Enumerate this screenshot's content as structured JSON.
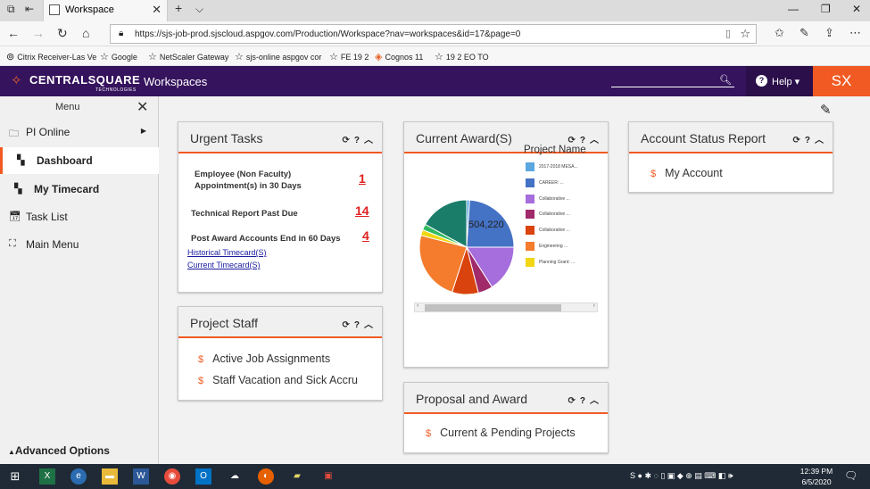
{
  "browser": {
    "tab_title": "Workspace",
    "url": "https://sjs-job-prod.sjscloud.aspgov.com/Production/Workspace?nav=workspaces&id=17&page=0",
    "favorites": [
      "Citrix Receiver-Las Ve",
      "Google",
      "NetScaler Gateway",
      "sjs-online aspgov cor",
      "FE 19 2",
      "Cognos 11",
      "19 2 EO TO"
    ]
  },
  "header": {
    "brand": "CENTRALSQUARE",
    "brand_sub": "TECHNOLOGIES",
    "section": "Workspaces",
    "help_label": "Help",
    "user_initials": "SX"
  },
  "sidebar": {
    "menu_label": "Menu",
    "items": [
      {
        "label": "PI Online"
      },
      {
        "label": "Dashboard"
      },
      {
        "label": "My Timecard"
      },
      {
        "label": "Task List"
      },
      {
        "label": "Main Menu"
      }
    ],
    "advanced_label": "Advanced Options"
  },
  "cards": {
    "urgent": {
      "title": "Urgent Tasks",
      "tasks": [
        {
          "label": "Employee (Non Faculty) Appointment(s) in 30 Days",
          "count": "1"
        },
        {
          "label": "Technical Report Past Due",
          "count": "14"
        },
        {
          "label": "Post Award Accounts End in 60 Days",
          "count": "4"
        }
      ],
      "links": [
        "Historical Timecard(S)",
        "Current Timecard(S)"
      ]
    },
    "staff": {
      "title": "Project Staff",
      "links": [
        "Active Job Assignments",
        "Staff Vacation and Sick Accru"
      ]
    },
    "award": {
      "title": "Current Award(S)",
      "legend_title": "Project Name",
      "more": "..."
    },
    "proposal": {
      "title": "Proposal and Award",
      "links": [
        "Current & Pending Projects"
      ]
    },
    "account": {
      "title": "Account Status Report",
      "links": [
        "My Account"
      ]
    }
  },
  "chart_data": {
    "type": "pie",
    "title": "",
    "legend_title": "Project Name",
    "slice_label": "504,220",
    "categories": [
      "2017-2018 MESA...",
      "CAREER: ...",
      "Collaborative ...",
      "Collaborative ...",
      "Collaborative ...",
      "Engineering ...",
      "Planning Grant: ...",
      "(unlisted)",
      "(unlisted)"
    ],
    "values": [
      1,
      24,
      16,
      5,
      9,
      24,
      2,
      2,
      17
    ],
    "colors": [
      "#5ba7e0",
      "#4472c4",
      "#a66ddc",
      "#a02a6a",
      "#d9430d",
      "#f47c2c",
      "#f2d612",
      "#2fba60",
      "#1a7d6a"
    ],
    "legend_placement": "right"
  },
  "taskbar": {
    "time": "12:39 PM",
    "date": "6/5/2020"
  }
}
